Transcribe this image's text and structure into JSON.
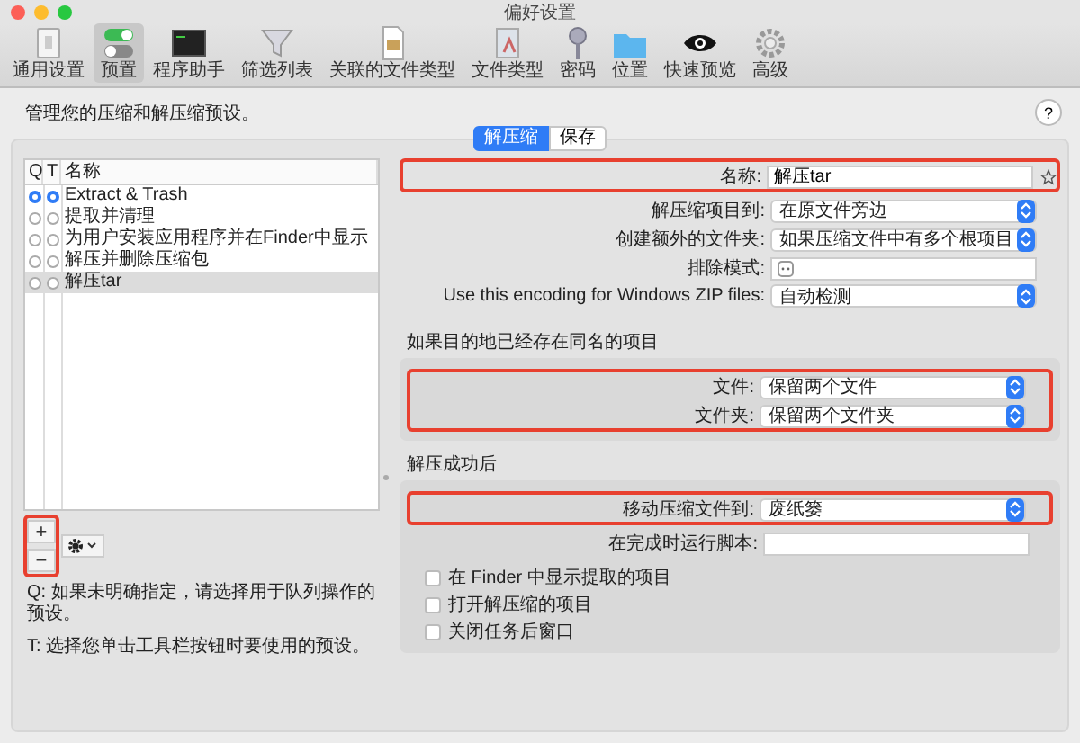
{
  "window": {
    "title": "偏好设置"
  },
  "toolbar": [
    {
      "label": "通用设置",
      "selected": false
    },
    {
      "label": "预置",
      "selected": true
    },
    {
      "label": "程序助手",
      "selected": false
    },
    {
      "label": "筛选列表",
      "selected": false
    },
    {
      "label": "关联的文件类型",
      "selected": false
    },
    {
      "label": "文件类型",
      "selected": false
    },
    {
      "label": "密码",
      "selected": false
    },
    {
      "label": "位置",
      "selected": false
    },
    {
      "label": "快速预览",
      "selected": false
    },
    {
      "label": "高级",
      "selected": false
    }
  ],
  "description": "管理您的压缩和解压缩预设。",
  "help_button": "?",
  "tabs": [
    {
      "label": "解压缩",
      "selected": true
    },
    {
      "label": "保存",
      "selected": false
    }
  ],
  "presets": {
    "columns": [
      "Q",
      "T",
      "名称"
    ],
    "rows": [
      {
        "name": "Extract & Trash",
        "q": true,
        "t": true,
        "selected": false
      },
      {
        "name": "提取并清理",
        "q": false,
        "t": false,
        "selected": false
      },
      {
        "name": "为用户安装应用程序并在Finder中显示",
        "q": false,
        "t": false,
        "selected": false
      },
      {
        "name": "解压并删除压缩包",
        "q": false,
        "t": false,
        "selected": false
      },
      {
        "name": "解压tar",
        "q": false,
        "t": false,
        "selected": true
      }
    ],
    "buttons": {
      "add": "+",
      "remove": "−",
      "highlighted": true
    }
  },
  "notes": [
    "Q: 如果未明确指定，请选择用于队列操作的预设。",
    "T: 选择您单击工具栏按钮时要使用的预设。"
  ],
  "form": [
    {
      "kind": "name",
      "label": "名称:",
      "value": "解压tar",
      "highlighted": true
    },
    {
      "kind": "popup",
      "label": "解压缩项目到:",
      "value": "在原文件旁边",
      "highlighted": false
    },
    {
      "kind": "popup",
      "label": "创建额外的文件夹:",
      "value": "如果压缩文件中有多个根项目",
      "highlighted": false
    },
    {
      "kind": "pattern",
      "label": "排除模式:",
      "highlighted": false
    },
    {
      "kind": "popup",
      "label": "Use this encoding for Windows ZIP files:",
      "value": "自动检测",
      "highlighted": false
    }
  ],
  "conflict": {
    "title": "如果目的地已经存在同名的项目",
    "rows": [
      {
        "kind": "popup",
        "label": "文件:",
        "value": "保留两个文件",
        "highlighted": true
      },
      {
        "kind": "popup",
        "label": "文件夹:",
        "value": "保留两个文件夹",
        "highlighted": true
      }
    ]
  },
  "after": {
    "title": "解压成功后",
    "rows": [
      {
        "kind": "popup",
        "label": "移动压缩文件到:",
        "value": "废纸篓",
        "highlighted": true
      },
      {
        "kind": "text",
        "label": "在完成时运行脚本:",
        "highlighted": false
      }
    ],
    "checkboxes": [
      {
        "label": "在 Finder 中显示提取的项目",
        "checked": false
      },
      {
        "label": "打开解压缩的项目",
        "checked": false
      },
      {
        "label": "关闭任务后窗口",
        "checked": false
      }
    ]
  }
}
